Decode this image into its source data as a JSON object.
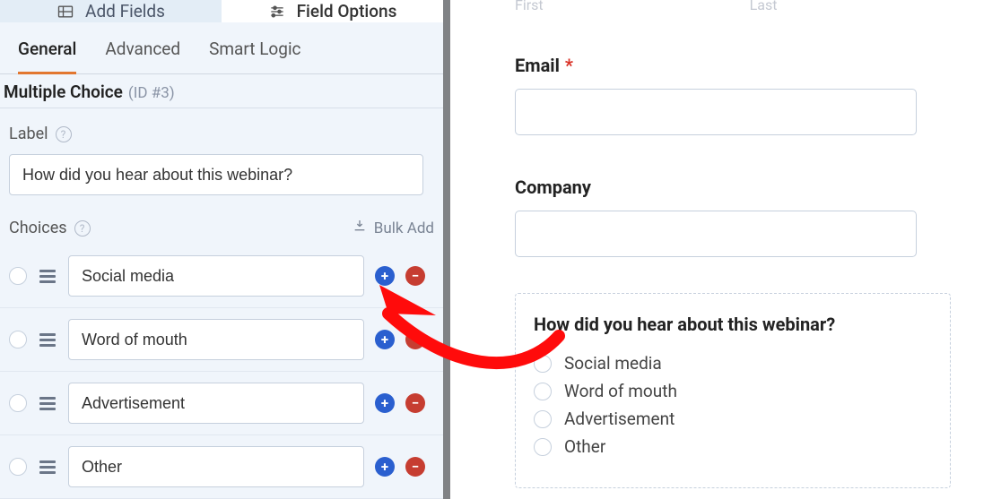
{
  "panelTabs": {
    "addFields": "Add Fields",
    "fieldOptions": "Field Options"
  },
  "subTabs": {
    "general": "General",
    "advanced": "Advanced",
    "smartLogic": "Smart Logic"
  },
  "fieldHeading": {
    "type": "Multiple Choice",
    "id": "(ID #3)"
  },
  "labelSection": {
    "label": "Label",
    "value": "How did you hear about this webinar?"
  },
  "choicesSection": {
    "label": "Choices",
    "bulkAdd": "Bulk Add",
    "items": [
      {
        "value": "Social media"
      },
      {
        "value": "Word of mouth"
      },
      {
        "value": "Advertisement"
      },
      {
        "value": "Other"
      }
    ]
  },
  "preview": {
    "topCutLabels": {
      "first": "First",
      "last": "Last"
    },
    "email": {
      "label": "Email",
      "required": "*"
    },
    "company": {
      "label": "Company"
    },
    "radio": {
      "title": "How did you hear about this webinar?",
      "options": [
        "Social media",
        "Word of mouth",
        "Advertisement",
        "Other"
      ]
    }
  }
}
